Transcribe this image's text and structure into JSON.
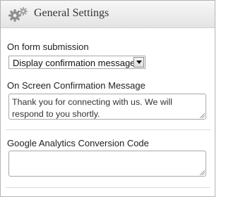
{
  "widget": {
    "title": "General Settings",
    "icon": "gears-icon"
  },
  "form_submission": {
    "label": "On form submission",
    "selected": "Display confirmation message"
  },
  "confirmation": {
    "label": "On Screen Confirmation Message",
    "value": "Thank you for connecting with us. We will respond to you shortly."
  },
  "analytics": {
    "label": "Google Analytics Conversion Code",
    "value": ""
  }
}
